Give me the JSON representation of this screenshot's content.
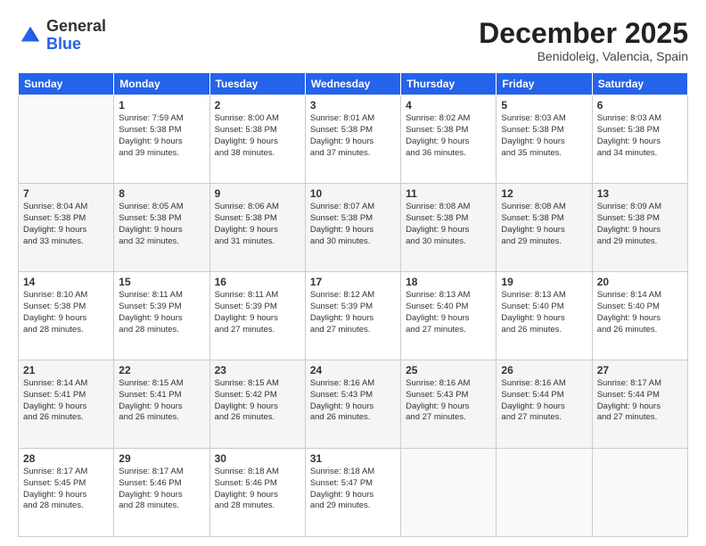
{
  "header": {
    "logo_general": "General",
    "logo_blue": "Blue",
    "month_title": "December 2025",
    "location": "Benidoleig, Valencia, Spain"
  },
  "days_of_week": [
    "Sunday",
    "Monday",
    "Tuesday",
    "Wednesday",
    "Thursday",
    "Friday",
    "Saturday"
  ],
  "weeks": [
    [
      {
        "day": "",
        "info": ""
      },
      {
        "day": "1",
        "info": "Sunrise: 7:59 AM\nSunset: 5:38 PM\nDaylight: 9 hours\nand 39 minutes."
      },
      {
        "day": "2",
        "info": "Sunrise: 8:00 AM\nSunset: 5:38 PM\nDaylight: 9 hours\nand 38 minutes."
      },
      {
        "day": "3",
        "info": "Sunrise: 8:01 AM\nSunset: 5:38 PM\nDaylight: 9 hours\nand 37 minutes."
      },
      {
        "day": "4",
        "info": "Sunrise: 8:02 AM\nSunset: 5:38 PM\nDaylight: 9 hours\nand 36 minutes."
      },
      {
        "day": "5",
        "info": "Sunrise: 8:03 AM\nSunset: 5:38 PM\nDaylight: 9 hours\nand 35 minutes."
      },
      {
        "day": "6",
        "info": "Sunrise: 8:03 AM\nSunset: 5:38 PM\nDaylight: 9 hours\nand 34 minutes."
      }
    ],
    [
      {
        "day": "7",
        "info": "Sunrise: 8:04 AM\nSunset: 5:38 PM\nDaylight: 9 hours\nand 33 minutes."
      },
      {
        "day": "8",
        "info": "Sunrise: 8:05 AM\nSunset: 5:38 PM\nDaylight: 9 hours\nand 32 minutes."
      },
      {
        "day": "9",
        "info": "Sunrise: 8:06 AM\nSunset: 5:38 PM\nDaylight: 9 hours\nand 31 minutes."
      },
      {
        "day": "10",
        "info": "Sunrise: 8:07 AM\nSunset: 5:38 PM\nDaylight: 9 hours\nand 30 minutes."
      },
      {
        "day": "11",
        "info": "Sunrise: 8:08 AM\nSunset: 5:38 PM\nDaylight: 9 hours\nand 30 minutes."
      },
      {
        "day": "12",
        "info": "Sunrise: 8:08 AM\nSunset: 5:38 PM\nDaylight: 9 hours\nand 29 minutes."
      },
      {
        "day": "13",
        "info": "Sunrise: 8:09 AM\nSunset: 5:38 PM\nDaylight: 9 hours\nand 29 minutes."
      }
    ],
    [
      {
        "day": "14",
        "info": "Sunrise: 8:10 AM\nSunset: 5:38 PM\nDaylight: 9 hours\nand 28 minutes."
      },
      {
        "day": "15",
        "info": "Sunrise: 8:11 AM\nSunset: 5:39 PM\nDaylight: 9 hours\nand 28 minutes."
      },
      {
        "day": "16",
        "info": "Sunrise: 8:11 AM\nSunset: 5:39 PM\nDaylight: 9 hours\nand 27 minutes."
      },
      {
        "day": "17",
        "info": "Sunrise: 8:12 AM\nSunset: 5:39 PM\nDaylight: 9 hours\nand 27 minutes."
      },
      {
        "day": "18",
        "info": "Sunrise: 8:13 AM\nSunset: 5:40 PM\nDaylight: 9 hours\nand 27 minutes."
      },
      {
        "day": "19",
        "info": "Sunrise: 8:13 AM\nSunset: 5:40 PM\nDaylight: 9 hours\nand 26 minutes."
      },
      {
        "day": "20",
        "info": "Sunrise: 8:14 AM\nSunset: 5:40 PM\nDaylight: 9 hours\nand 26 minutes."
      }
    ],
    [
      {
        "day": "21",
        "info": "Sunrise: 8:14 AM\nSunset: 5:41 PM\nDaylight: 9 hours\nand 26 minutes."
      },
      {
        "day": "22",
        "info": "Sunrise: 8:15 AM\nSunset: 5:41 PM\nDaylight: 9 hours\nand 26 minutes."
      },
      {
        "day": "23",
        "info": "Sunrise: 8:15 AM\nSunset: 5:42 PM\nDaylight: 9 hours\nand 26 minutes."
      },
      {
        "day": "24",
        "info": "Sunrise: 8:16 AM\nSunset: 5:43 PM\nDaylight: 9 hours\nand 26 minutes."
      },
      {
        "day": "25",
        "info": "Sunrise: 8:16 AM\nSunset: 5:43 PM\nDaylight: 9 hours\nand 27 minutes."
      },
      {
        "day": "26",
        "info": "Sunrise: 8:16 AM\nSunset: 5:44 PM\nDaylight: 9 hours\nand 27 minutes."
      },
      {
        "day": "27",
        "info": "Sunrise: 8:17 AM\nSunset: 5:44 PM\nDaylight: 9 hours\nand 27 minutes."
      }
    ],
    [
      {
        "day": "28",
        "info": "Sunrise: 8:17 AM\nSunset: 5:45 PM\nDaylight: 9 hours\nand 28 minutes."
      },
      {
        "day": "29",
        "info": "Sunrise: 8:17 AM\nSunset: 5:46 PM\nDaylight: 9 hours\nand 28 minutes."
      },
      {
        "day": "30",
        "info": "Sunrise: 8:18 AM\nSunset: 5:46 PM\nDaylight: 9 hours\nand 28 minutes."
      },
      {
        "day": "31",
        "info": "Sunrise: 8:18 AM\nSunset: 5:47 PM\nDaylight: 9 hours\nand 29 minutes."
      },
      {
        "day": "",
        "info": ""
      },
      {
        "day": "",
        "info": ""
      },
      {
        "day": "",
        "info": ""
      }
    ]
  ]
}
